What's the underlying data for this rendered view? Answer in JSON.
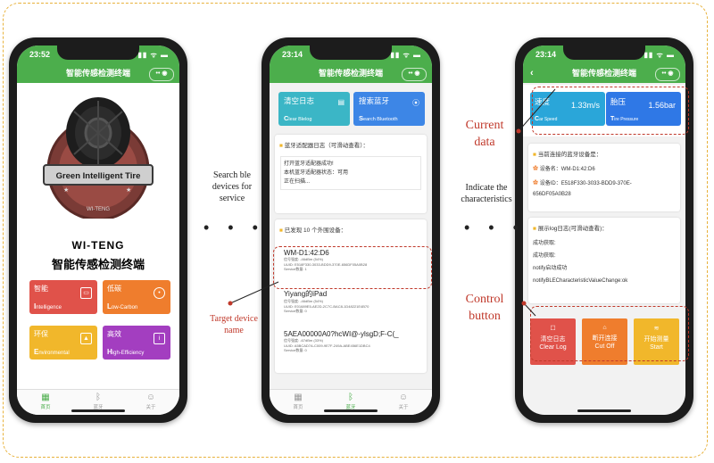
{
  "status_times": [
    "23:52",
    "23:14",
    "23:14"
  ],
  "signal": "▮▮ ᯤ ▬",
  "app_title": "智能传感检测终端",
  "capsule": "•• ◉",
  "tabs": [
    {
      "label": "首页",
      "icon": "grid-icon"
    },
    {
      "label": "蓝牙",
      "icon": "bluetooth-icon"
    },
    {
      "label": "关于",
      "icon": "person-icon"
    }
  ],
  "home": {
    "logo_text": "Green Intelligent Tire",
    "logo_bottom": "WI-TENG",
    "brand_en": "WI-TENG",
    "brand_cn": "智能传感检测终端",
    "features": [
      {
        "cn": "智能",
        "en_cap": "I",
        "en_rest": "ntelligence",
        "color": "#e0524a",
        "icon": "card-icon"
      },
      {
        "cn": "低碳",
        "en_cap": "L",
        "en_rest": "ow-Carbon",
        "color": "#ef7d2d",
        "icon": "palette-icon"
      },
      {
        "cn": "环保",
        "en_cap": "E",
        "en_rest": "nvironmental",
        "color": "#f1b72b",
        "icon": "image-icon"
      },
      {
        "cn": "高效",
        "en_cap": "H",
        "en_rest": "igh-Efficiency",
        "color": "#a33ec0",
        "icon": "info-icon"
      }
    ]
  },
  "bluetooth": {
    "clear_btn": {
      "cn": "清空日志",
      "en_cap": "C",
      "en_rest": "lear Blelog",
      "color": "#3bb6c6"
    },
    "search_btn": {
      "cn": "搜索蓝牙",
      "en_cap": "S",
      "en_rest": "earch Bluetooth",
      "color": "#3d86e6"
    },
    "log_title": "蓝牙适配器日志（可滑动查看）：",
    "log_lines": [
      "打开蓝牙适配器成功!",
      "本机蓝牙适配器状态：可用",
      "正在扫描..."
    ],
    "found_title": "已发现 10 个外围设备：",
    "devices": [
      {
        "name": "WM-D1:42:D6",
        "rssi": "信号强度: -46dBm (54%)",
        "uuid": "UUID: E518F330-3033-BDD9-370E-656DF05A0B28",
        "service": "Service数量: 1"
      },
      {
        "name": "Yiyang的iPad",
        "rssi": "信号强度: -46dBm (54%)",
        "uuid": "UUID: E01689E5-AE2D-2C7C-BAC8-1D48221E4B70",
        "service": "Service数量: 0"
      },
      {
        "name": "5AEA00000A0?hcWI@-ylsgD;F-C(_",
        "rssi": "信号强度: -67dBm (33%)",
        "uuid": "UUID: A5BCAD7A-C009-9E7F-249A-ABE456E1DBC4",
        "service": "Service数量: 0"
      }
    ]
  },
  "monitor": {
    "speed": {
      "cn": "速度",
      "value": "1.33m/s",
      "en_cap": "C",
      "en_rest": "ar Speed"
    },
    "pressure": {
      "cn": "胎压",
      "value": "1.56bar",
      "en_cap": "T",
      "en_rest": "ire Pressure"
    },
    "conn_title": "当前连接的蓝牙设备是：",
    "device_name": "设备名：WM-D1:42:D6",
    "device_id_1": "设备ID：E518F330-3033-BDD9-370E-",
    "device_id_2": "656DF05A0B28",
    "log_title": "展示log日志(可滑动查看)：",
    "log_lines": [
      "成功获取:",
      "成功获取:",
      "notify启动成功",
      "notifyBLECharacteristicValueChange:ok"
    ],
    "controls": [
      {
        "l1": "清空日志",
        "l2": "Clear Log",
        "icon": "☐",
        "color": "#e0524a"
      },
      {
        "l1": "断开连接",
        "l2": "Cut Off",
        "icon": "⌂",
        "color": "#ef7d2d"
      },
      {
        "l1": "开始测量",
        "l2": "Start",
        "icon": "≋",
        "color": "#f1b72b"
      }
    ]
  },
  "annotations": {
    "search": [
      "Search ble",
      "devices for",
      "service"
    ],
    "characteristics": [
      "Indicate the",
      "characteristics"
    ],
    "target": [
      "Target device",
      "name"
    ],
    "current": [
      "Current",
      "data"
    ],
    "control": [
      "Control",
      "button"
    ],
    "dots": "• • •"
  },
  "colors": {
    "green": "#4cae4c",
    "red_dash": "#c0392b",
    "frame": "#e8b23c"
  }
}
